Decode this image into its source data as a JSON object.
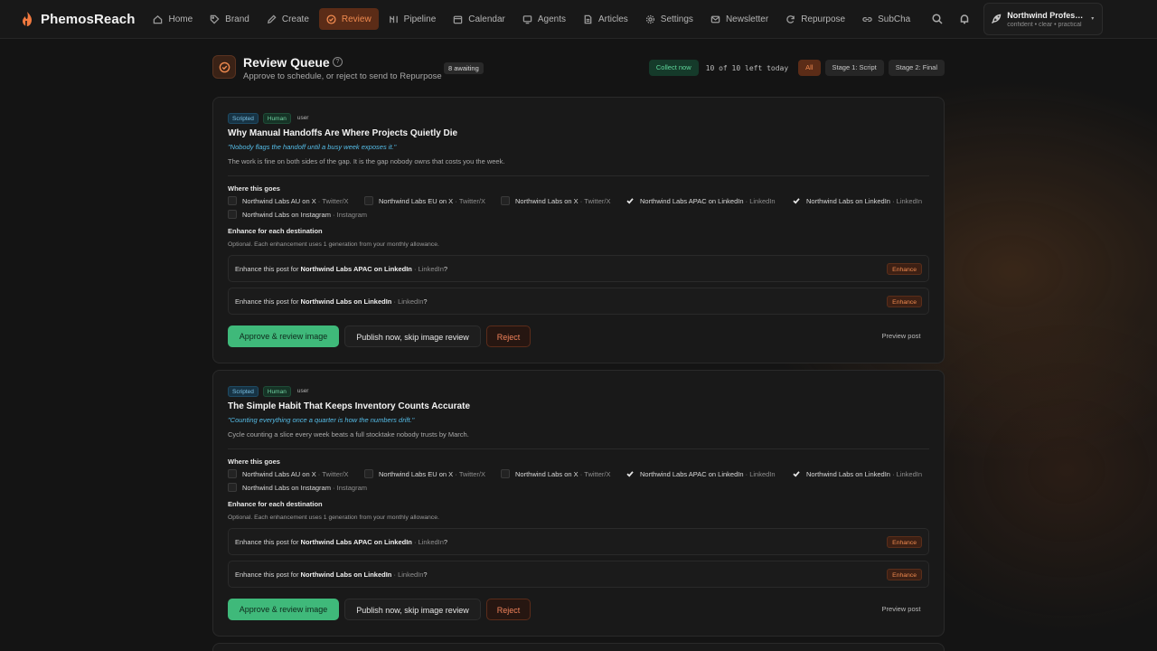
{
  "nav": {
    "brand": "PhemosReach",
    "items": [
      {
        "label": "Home",
        "icon": "home-icon"
      },
      {
        "label": "Brand",
        "icon": "tag-icon"
      },
      {
        "label": "Create",
        "icon": "pencil-icon"
      },
      {
        "label": "Review",
        "icon": "check-circle-icon",
        "active": true
      },
      {
        "label": "Pipeline",
        "icon": "pipeline-icon"
      },
      {
        "label": "Calendar",
        "icon": "calendar-icon"
      },
      {
        "label": "Agents",
        "icon": "monitor-icon"
      },
      {
        "label": "Articles",
        "icon": "document-icon"
      },
      {
        "label": "Settings",
        "icon": "gear-icon"
      },
      {
        "label": "Newsletter",
        "icon": "mail-icon"
      },
      {
        "label": "Repurpose",
        "icon": "refresh-icon"
      },
      {
        "label": "SubCha",
        "icon": "link-icon"
      }
    ],
    "account": {
      "name": "Northwind Professional",
      "subtitle": "confident • clear • practical"
    }
  },
  "header": {
    "title": "Review Queue",
    "subtitle": "Approve to schedule, or reject to send to Repurpose",
    "badge": "8 awaiting",
    "collect_label": "Collect now",
    "quota": "10 of 10 left today",
    "filters": [
      {
        "label": "All",
        "active": true
      },
      {
        "label": "Stage 1: Script"
      },
      {
        "label": "Stage 2: Final"
      }
    ]
  },
  "labels": {
    "where_goes": "Where this goes",
    "enhance_heading": "Enhance for each destination",
    "enhance_note": "Optional. Each enhancement uses 1 generation from your monthly allowance.",
    "enhance_prefix": "Enhance this post for ",
    "enhance_btn": "Enhance",
    "approve": "Approve & review image",
    "publish": "Publish now, skip image review",
    "reject": "Reject",
    "preview": "Preview post"
  },
  "cards": [
    {
      "tags": [
        "Scripted",
        "Human",
        "user"
      ],
      "title": "Why Manual Handoffs Are Where Projects Quietly Die",
      "hook": "\"Nobody flags the handoff until a busy week exposes it.\"",
      "summary": "The work is fine on both sides of the gap. It is the gap nobody owns that costs you the week.",
      "destinations": [
        {
          "name": "Northwind Labs AU on X",
          "platform": "Twitter/X",
          "checked": false
        },
        {
          "name": "Northwind Labs EU on X",
          "platform": "Twitter/X",
          "checked": false
        },
        {
          "name": "Northwind Labs on X",
          "platform": "Twitter/X",
          "checked": false
        },
        {
          "name": "Northwind Labs APAC on LinkedIn",
          "platform": "LinkedIn",
          "checked": true
        },
        {
          "name": "Northwind Labs on LinkedIn",
          "platform": "LinkedIn",
          "checked": true
        },
        {
          "name": "Northwind Labs on Instagram",
          "platform": "Instagram",
          "checked": false
        }
      ],
      "enhance": [
        {
          "name": "Northwind Labs APAC on LinkedIn",
          "platform": "LinkedIn"
        },
        {
          "name": "Northwind Labs on LinkedIn",
          "platform": "LinkedIn"
        }
      ]
    },
    {
      "tags": [
        "Scripted",
        "Human",
        "user"
      ],
      "title": "The Simple Habit That Keeps Inventory Counts Accurate",
      "hook": "\"Counting everything once a quarter is how the numbers drift.\"",
      "summary": "Cycle counting a slice every week beats a full stocktake nobody trusts by March.",
      "destinations": [
        {
          "name": "Northwind Labs AU on X",
          "platform": "Twitter/X",
          "checked": false
        },
        {
          "name": "Northwind Labs EU on X",
          "platform": "Twitter/X",
          "checked": false
        },
        {
          "name": "Northwind Labs on X",
          "platform": "Twitter/X",
          "checked": false
        },
        {
          "name": "Northwind Labs APAC on LinkedIn",
          "platform": "LinkedIn",
          "checked": true
        },
        {
          "name": "Northwind Labs on LinkedIn",
          "platform": "LinkedIn",
          "checked": true
        },
        {
          "name": "Northwind Labs on Instagram",
          "platform": "Instagram",
          "checked": false
        }
      ],
      "enhance": [
        {
          "name": "Northwind Labs APAC on LinkedIn",
          "platform": "LinkedIn"
        },
        {
          "name": "Northwind Labs on LinkedIn",
          "platform": "LinkedIn"
        }
      ]
    }
  ]
}
